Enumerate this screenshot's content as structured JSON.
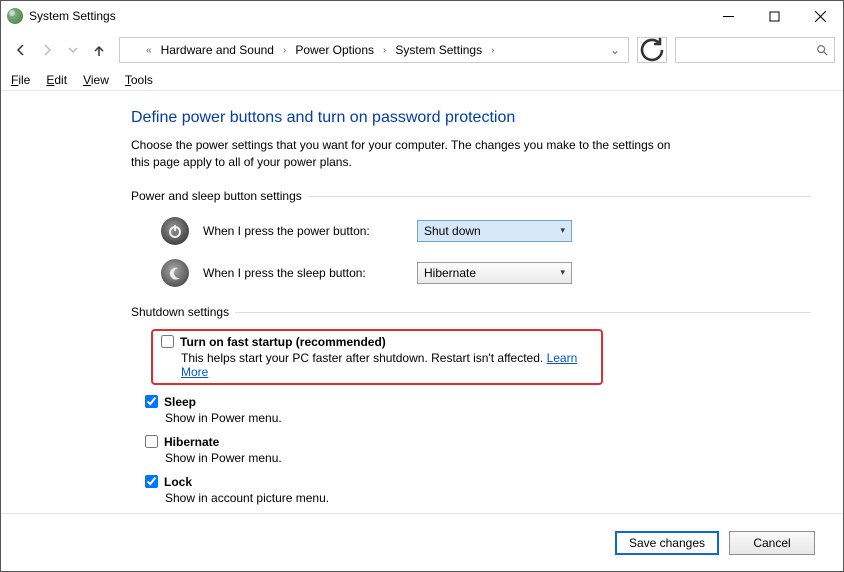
{
  "window": {
    "title": "System Settings"
  },
  "breadcrumb": {
    "a": "Hardware and Sound",
    "b": "Power Options",
    "c": "System Settings"
  },
  "menu": {
    "file": "File",
    "edit": "Edit",
    "view": "View",
    "tools": "Tools"
  },
  "page": {
    "title": "Define power buttons and turn on password protection",
    "desc": "Choose the power settings that you want for your computer. The changes you make to the settings on this page apply to all of your power plans."
  },
  "group1": {
    "label": "Power and sleep button settings",
    "powerLabel": "When I press the power button:",
    "powerValue": "Shut down",
    "sleepLabel": "When I press the sleep button:",
    "sleepValue": "Hibernate"
  },
  "group2": {
    "label": "Shutdown settings"
  },
  "checks": {
    "fast": {
      "title": "Turn on fast startup (recommended)",
      "sub": "This helps start your PC faster after shutdown. Restart isn't affected. ",
      "link": "Learn More",
      "checked": false
    },
    "sleep": {
      "title": "Sleep",
      "sub": "Show in Power menu.",
      "checked": true
    },
    "hibernate": {
      "title": "Hibernate",
      "sub": "Show in Power menu.",
      "checked": false
    },
    "lock": {
      "title": "Lock",
      "sub": "Show in account picture menu.",
      "checked": true
    }
  },
  "footer": {
    "save": "Save changes",
    "cancel": "Cancel"
  }
}
